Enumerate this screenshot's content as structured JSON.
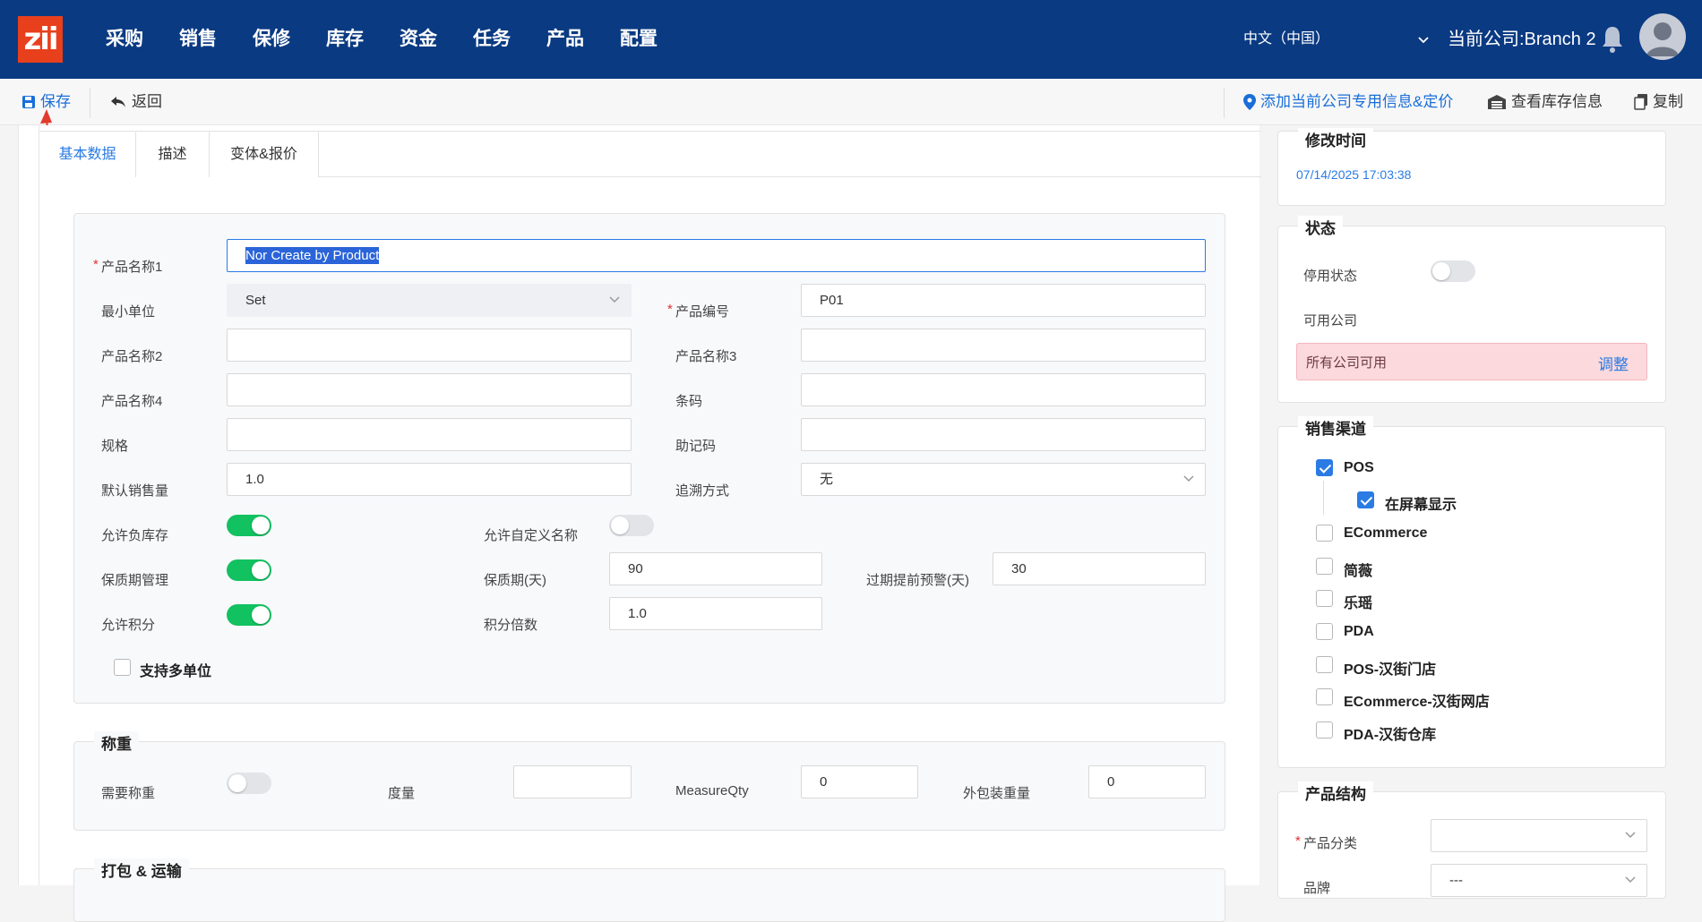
{
  "app": {
    "logo": "zii"
  },
  "nav": {
    "items": [
      "采购",
      "销售",
      "保修",
      "库存",
      "资金",
      "任务",
      "产品",
      "配置"
    ]
  },
  "header": {
    "language": "中文（中国）",
    "company": "当前公司:Branch 2"
  },
  "toolbar": {
    "save": "保存",
    "back": "返回",
    "add_company_info": "添加当前公司专用信息&定价",
    "view_stock": "查看库存信息",
    "copy": "复制"
  },
  "tabs": [
    "基本数据",
    "描述",
    "变体&报价"
  ],
  "form": {
    "name1_label": "产品名称1",
    "name1_value": "Nor Create by Product",
    "min_unit_label": "最小单位",
    "min_unit_value": "Set",
    "code_label": "产品编号",
    "code_value": "P01",
    "name2_label": "产品名称2",
    "name3_label": "产品名称3",
    "name4_label": "产品名称4",
    "barcode_label": "条码",
    "spec_label": "规格",
    "mnemonic_label": "助记码",
    "default_qty_label": "默认销售量",
    "default_qty_value": "1.0",
    "trace_label": "追溯方式",
    "trace_value": "无",
    "neg_stock_label": "允许负库存",
    "custom_name_label": "允许自定义名称",
    "shelf_mgmt_label": "保质期管理",
    "shelf_days_label": "保质期(天)",
    "shelf_days_value": "90",
    "expiry_warn_label": "过期提前预警(天)",
    "expiry_warn_value": "30",
    "points_label": "允许积分",
    "points_mult_label": "积分倍数",
    "points_mult_value": "1.0",
    "multi_unit_label": "支持多单位"
  },
  "toggles": {
    "neg_stock": true,
    "custom_name": false,
    "shelf_mgmt": true,
    "points": true,
    "need_weigh": false,
    "disabled": false
  },
  "weighing": {
    "title": "称重",
    "need_weigh_label": "需要称重",
    "measure_label": "度量",
    "measure_qty_label": "MeasureQty",
    "measure_qty_value": "0",
    "outer_weight_label": "外包装重量",
    "outer_weight_value": "0"
  },
  "packing": {
    "title": "打包 & 运输"
  },
  "side": {
    "modified_title": "修改时间",
    "modified_value": "07/14/2025 17:03:38",
    "status_title": "状态",
    "disabled_label": "停用状态",
    "company_label": "可用公司",
    "company_alert": "所有公司可用",
    "adjust": "调整",
    "channels_title": "销售渠道",
    "channels": [
      {
        "label": "POS",
        "checked": true
      },
      {
        "label": "在屏幕显示",
        "checked": true
      },
      {
        "label": "ECommerce",
        "checked": false
      },
      {
        "label": "简薇",
        "checked": false
      },
      {
        "label": "乐瑶",
        "checked": false
      },
      {
        "label": "PDA",
        "checked": false
      },
      {
        "label": "POS-汉街门店",
        "checked": false
      },
      {
        "label": "ECommerce-汉街网店",
        "checked": false
      },
      {
        "label": "PDA-汉街仓库",
        "checked": false
      }
    ],
    "structure_title": "产品结构",
    "category_label": "产品分类",
    "brand_label": "品牌",
    "brand_value": "---"
  },
  "colors": {
    "nav_bg": "#0a3a82",
    "accent": "#2a7be4",
    "toggle_on": "#12c160",
    "alert_bg": "#fbd9dc",
    "logo": "#e8401c"
  }
}
